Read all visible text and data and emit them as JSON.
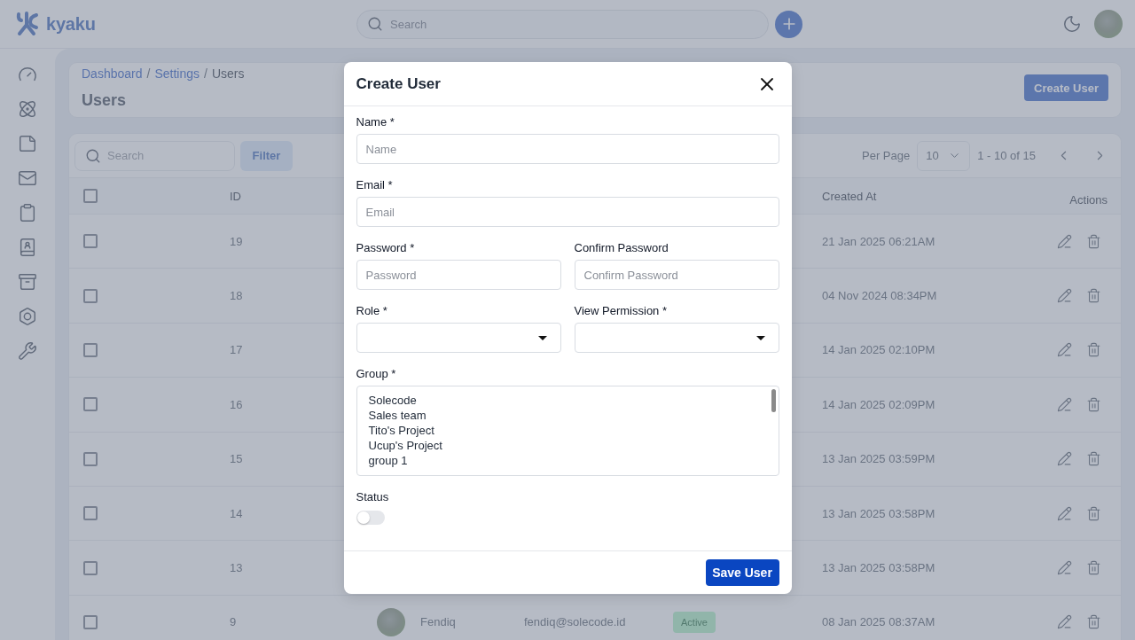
{
  "header": {
    "logo": "kyaku",
    "search": {
      "placeholder": "Search"
    }
  },
  "page": {
    "breadcrumb": {
      "separator": "/",
      "items": [
        {
          "label": "Dashboard",
          "kind": "link"
        },
        {
          "label": "Settings",
          "kind": "link"
        },
        {
          "label": "Users",
          "kind": "current"
        }
      ]
    },
    "title": "Users",
    "create_button": "Create User"
  },
  "toolbar": {
    "search": {
      "placeholder": "Search"
    },
    "filter_button": "Filter",
    "per_page_label": "Per Page",
    "per_page_value": "10",
    "range": "1 - 10 of 15"
  },
  "table": {
    "select_all_checked": false,
    "columns": {
      "id": "ID",
      "created_at": "Created At",
      "actions": "Actions"
    },
    "rows": [
      {
        "checked": false,
        "id": "19",
        "created_at": "21 Jan 2025 06:21AM"
      },
      {
        "checked": false,
        "id": "18",
        "created_at": "04 Nov 2024 08:34PM"
      },
      {
        "checked": false,
        "id": "17",
        "created_at": "14 Jan 2025 02:10PM"
      },
      {
        "checked": false,
        "id": "16",
        "created_at": "14 Jan 2025 02:09PM"
      },
      {
        "checked": false,
        "id": "15",
        "created_at": "13 Jan 2025 03:59PM"
      },
      {
        "checked": false,
        "id": "14",
        "created_at": "13 Jan 2025 03:58PM"
      },
      {
        "checked": false,
        "id": "13",
        "created_at": "13 Jan 2025 03:58PM"
      },
      {
        "checked": false,
        "id": "9",
        "name": "Fendiq",
        "email": "fendiq@solecode.id",
        "status": {
          "label": "Active",
          "kind": "active"
        },
        "created_at": "08 Jan 2025 08:37AM"
      }
    ]
  },
  "modal": {
    "title": "Create User",
    "rows": [
      {
        "fields": [
          {
            "kind": "text",
            "label": "Name *",
            "placeholder": "Name"
          }
        ]
      },
      {
        "fields": [
          {
            "kind": "text",
            "label": "Email *",
            "placeholder": "Email"
          }
        ]
      },
      {
        "fields": [
          {
            "kind": "text",
            "label": "Password *",
            "placeholder": "Password"
          },
          {
            "kind": "text",
            "label": "Confirm Password",
            "placeholder": "Confirm Password"
          }
        ]
      },
      {
        "fields": [
          {
            "kind": "select",
            "label": "Role *"
          },
          {
            "kind": "select",
            "label": "View Permission *"
          }
        ]
      },
      {
        "fields": [
          {
            "kind": "listbox",
            "label": "Group *",
            "options": [
              {
                "label": "Solecode",
                "selected": false
              },
              {
                "label": "Sales team",
                "selected": false
              },
              {
                "label": "Tito's Project",
                "selected": false
              },
              {
                "label": "Ucup's Project",
                "selected": false
              },
              {
                "label": "group 1",
                "selected": false
              }
            ]
          }
        ]
      },
      {
        "fields": [
          {
            "kind": "toggle",
            "label": "Status",
            "on": false
          }
        ]
      }
    ],
    "save_button": "Save User"
  }
}
